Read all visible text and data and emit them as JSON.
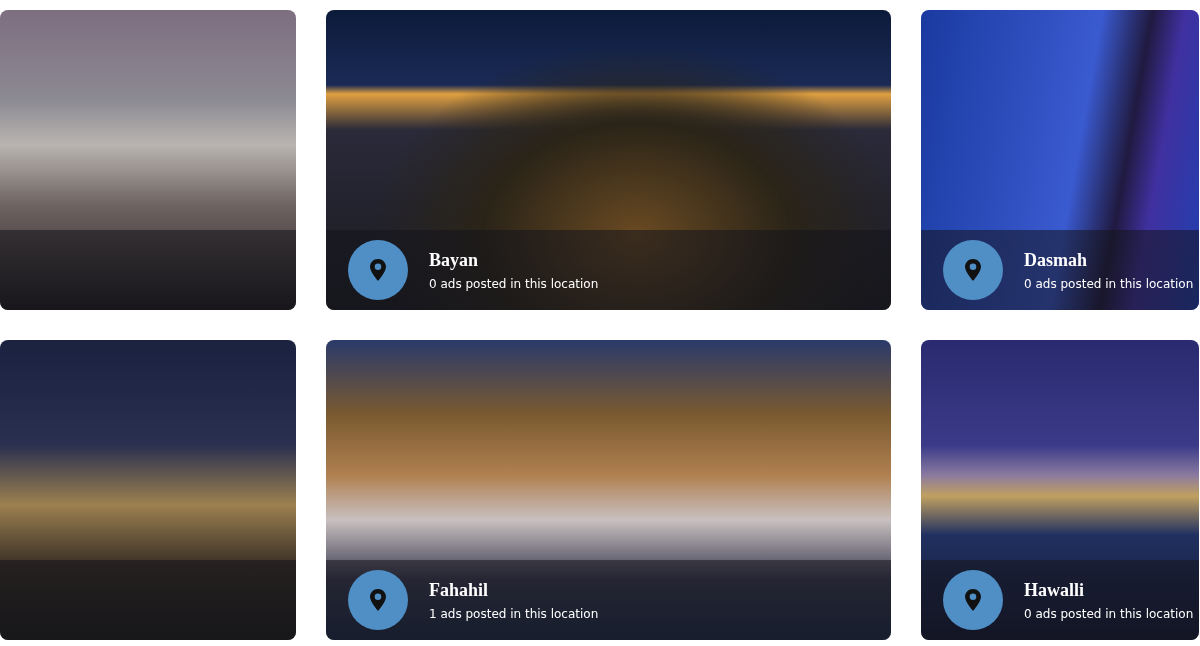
{
  "rows": [
    {
      "partial_card": true,
      "cards": [
        {
          "name": "Bayan",
          "ads": "0 ads posted in this location"
        },
        {
          "name": "Dasmah",
          "ads": "0 ads posted in this location"
        }
      ]
    },
    {
      "partial_card": true,
      "cards": [
        {
          "name": "Fahahil",
          "ads": "1 ads posted in this location"
        },
        {
          "name": "Hawalli",
          "ads": "0 ads posted in this location"
        }
      ]
    }
  ]
}
